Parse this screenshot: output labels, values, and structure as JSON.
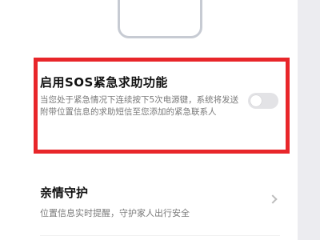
{
  "sos_setting": {
    "title": "启用SOS紧急求助功能",
    "description": "当您处于紧急情况下连续按下5次电源键，系统将发送附带位置信息的求助短信至您添加的紧急联系人",
    "toggle_state": "off"
  },
  "family_guard": {
    "title": "亲情守护",
    "description": "位置信息实时提醒，守护家人出行安全"
  },
  "colors": {
    "highlight": "#e8262a",
    "toggle_off": "#e3e3e6"
  }
}
